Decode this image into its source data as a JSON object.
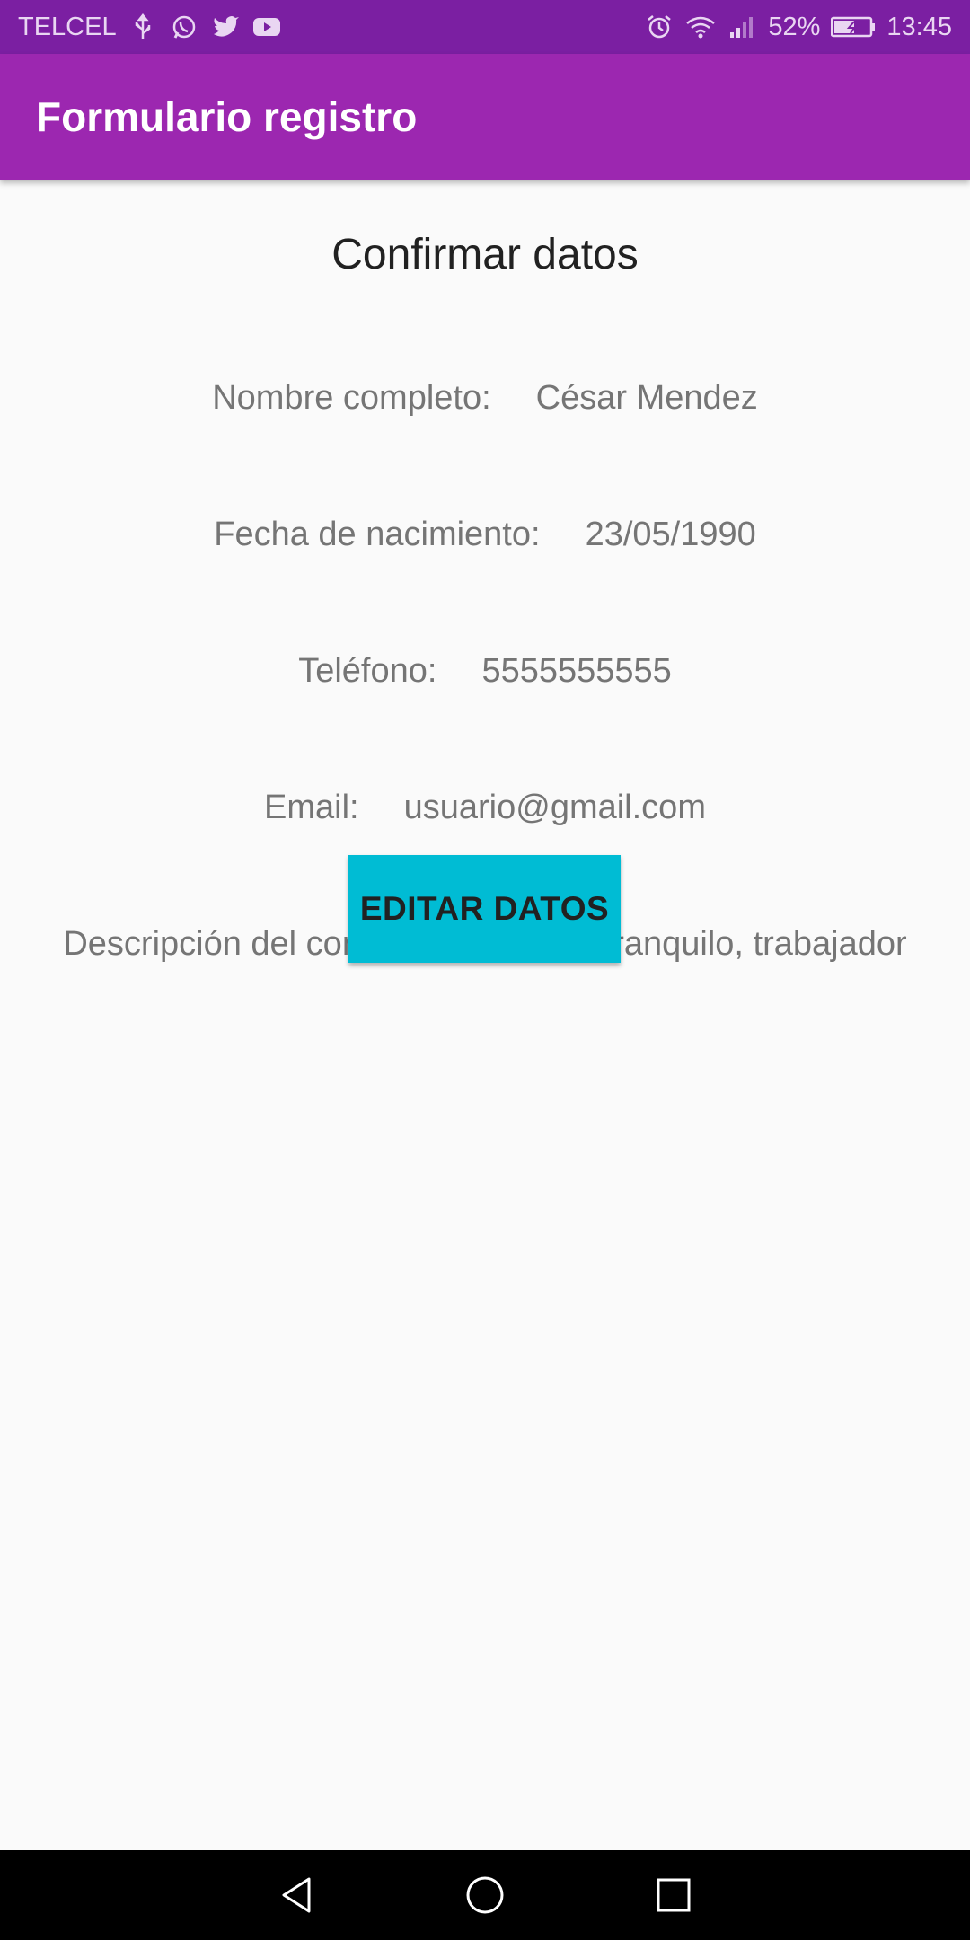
{
  "status_bar": {
    "carrier": "TELCEL",
    "battery": "52%",
    "time": "13:45",
    "left_icons": [
      "usb-icon",
      "whatsapp-icon",
      "twitter-icon",
      "youtube-icon"
    ],
    "right_icons": [
      "alarm-icon",
      "wifi-icon",
      "signal-icon",
      "battery-icon"
    ]
  },
  "app_bar": {
    "title": "Formulario registro"
  },
  "main": {
    "title": "Confirmar datos",
    "fields": [
      {
        "label": "Nombre completo:",
        "value": "César Mendez"
      },
      {
        "label": "Fecha de nacimiento:",
        "value": "23/05/1990"
      },
      {
        "label": "Teléfono:",
        "value": "5555555555"
      },
      {
        "label": "Email:",
        "value": "usuario@gmail.com"
      },
      {
        "label": "Descripción del contacto:",
        "value": "alegre, tranquilo, trabajador"
      }
    ],
    "edit_button_label": "EDITAR DATOS"
  },
  "nav_bar": {
    "buttons": [
      "back-icon",
      "home-icon",
      "recents-icon"
    ]
  },
  "colors": {
    "status_bar": "#7b1fa2",
    "app_bar": "#9c27b0",
    "button": "#00bcd4",
    "background": "#fafafa"
  }
}
